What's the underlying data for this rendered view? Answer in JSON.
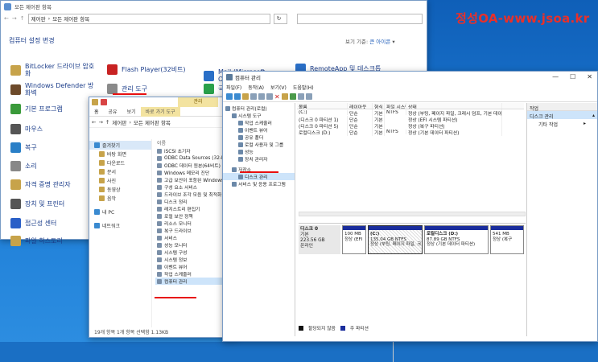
{
  "watermark": "정성OA-www.jsoa.kr",
  "control_panel": {
    "title": "모든 제어판 항목",
    "breadcrumb": [
      "제어판",
      "모든 제어판 항목"
    ],
    "header": "컴퓨터 설정 변경",
    "view_by_label": "보기 기준:",
    "view_by_value": "큰 아이콘",
    "items": [
      {
        "label": "BitLocker 드라이브 암호화",
        "color": "#c7a34a"
      },
      {
        "label": "Flash Player(32비트)",
        "color": "#c82222"
      },
      {
        "label": "Mail (Microsoft Outlook)",
        "color": "#2a6fc7"
      },
      {
        "label": "RemoteApp 및 데스크톱",
        "color": "#2a6fc7"
      },
      {
        "label": "Windows Defender 방화벽",
        "color": "#6d4a2a"
      },
      {
        "label": "관리 도구",
        "color": "#8a8a8a"
      },
      {
        "label": "국",
        "color": "#2aa04a"
      },
      {
        "label": "기본 프로그램",
        "color": "#3a9a3a"
      },
      {
        "label": "마우스",
        "color": "#555555"
      },
      {
        "label": "복구",
        "color": "#2a7fc7"
      },
      {
        "label": "소리",
        "color": "#888888"
      },
      {
        "label": "자격 증명 관리자",
        "color": "#c7a34a"
      },
      {
        "label": "장치 및 프린터",
        "color": "#555555"
      },
      {
        "label": "접근성 센터",
        "color": "#2a5fc7"
      },
      {
        "label": "파일 히스토리",
        "color": "#c7a34a"
      }
    ]
  },
  "explorer": {
    "ribbon_manage": "관리",
    "ribbon_tabs": [
      "파일",
      "홈",
      "공유",
      "보기",
      "바로 가기 도구"
    ],
    "breadcrumb": [
      "제어판",
      "모든 제어판 항목"
    ],
    "nav": [
      {
        "label": "즐겨찾기",
        "level": "top"
      },
      {
        "label": "바탕 화면",
        "level": "sub"
      },
      {
        "label": "다운로드",
        "level": "sub"
      },
      {
        "label": "문서",
        "level": "sub"
      },
      {
        "label": "사진",
        "level": "sub"
      },
      {
        "label": "동영상",
        "level": "sub"
      },
      {
        "label": "음악",
        "level": "sub"
      },
      {
        "label": "내 PC",
        "level": "lvl"
      },
      {
        "label": "네트워크",
        "level": "lvl"
      }
    ],
    "column": "이름",
    "files": [
      "iSCSI 초기자",
      "ODBC Data Sources (32-bit)",
      "ODBC 데이터 원본(64비트)",
      "Windows 메모리 진단",
      "고급 보안이 포함된 Windows",
      "구성 요소 서비스",
      "드라이브 조각 모음 및 최적화",
      "디스크 정리",
      "레지스트리 편집기",
      "로컬 보안 정책",
      "리소스 모니터",
      "복구 드라이브",
      "서비스",
      "성능 모니터",
      "시스템 구성",
      "시스템 정보",
      "이벤트 뷰어",
      "작업 스케줄러",
      "컴퓨터 관리"
    ],
    "selected": "컴퓨터 관리",
    "status": "19개 항목   1개 항목 선택함 1.13KB"
  },
  "computer_mgmt": {
    "title": "컴퓨터 관리",
    "menu": [
      "파일(F)",
      "동작(A)",
      "보기(V)",
      "도움말(H)"
    ],
    "tree": [
      {
        "label": "컴퓨터 관리(로컬)",
        "indent": 0
      },
      {
        "label": "시스템 도구",
        "indent": 1
      },
      {
        "label": "작업 스케줄러",
        "indent": 2
      },
      {
        "label": "이벤트 뷰어",
        "indent": 2
      },
      {
        "label": "공유 폴더",
        "indent": 2
      },
      {
        "label": "로컬 사용자 및 그룹",
        "indent": 2
      },
      {
        "label": "성능",
        "indent": 2
      },
      {
        "label": "장치 관리자",
        "indent": 2
      },
      {
        "label": "저장소",
        "indent": 1
      },
      {
        "label": "디스크 관리",
        "indent": 2
      },
      {
        "label": "서비스 및 응용 프로그램",
        "indent": 1
      }
    ],
    "tree_selected": "디스크 관리",
    "vol_columns": [
      "볼륨",
      "레이아웃",
      "형식",
      "파일 시스템",
      "상태"
    ],
    "volumes": [
      [
        "(C:)",
        "단순",
        "기본",
        "NTFS",
        "정상 (부팅, 페이지 파일, 크래시 덤프, 기본 데이터"
      ],
      [
        "(디스크 0 파티션 1)",
        "단순",
        "기본",
        "",
        "정상 (EFI 시스템 파티션)"
      ],
      [
        "(디스크 0 파티션 5)",
        "단순",
        "기본",
        "",
        "정상 (복구 파티션)"
      ],
      [
        "로컬디스크 (D:)",
        "단순",
        "기본",
        "NTFS",
        "정상 (기본 데이터 파티션)"
      ]
    ],
    "disk": {
      "name": "디스크 0",
      "type": "기본",
      "size": "223.56 GB",
      "state": "온라인"
    },
    "partitions": [
      {
        "line1": "",
        "line2": "100 MB",
        "line3": "정상 (EFI"
      },
      {
        "line1": "(C:)",
        "line2": "135.04 GB NTFS",
        "line3": "정상 (부팅, 페이지 파일, 크"
      },
      {
        "line1": "로컬디스크 (D:)",
        "line2": "87.89 GB NTFS",
        "line3": "정상 (기본 데이터 파티션)"
      },
      {
        "line1": "",
        "line2": "541 MB",
        "line3": "정상 (복구"
      }
    ],
    "legend": [
      "할당되지 않음",
      "주 파티션"
    ],
    "actions_header": "작업",
    "actions_section": "디스크 관리",
    "actions_more": "기타 작업"
  }
}
